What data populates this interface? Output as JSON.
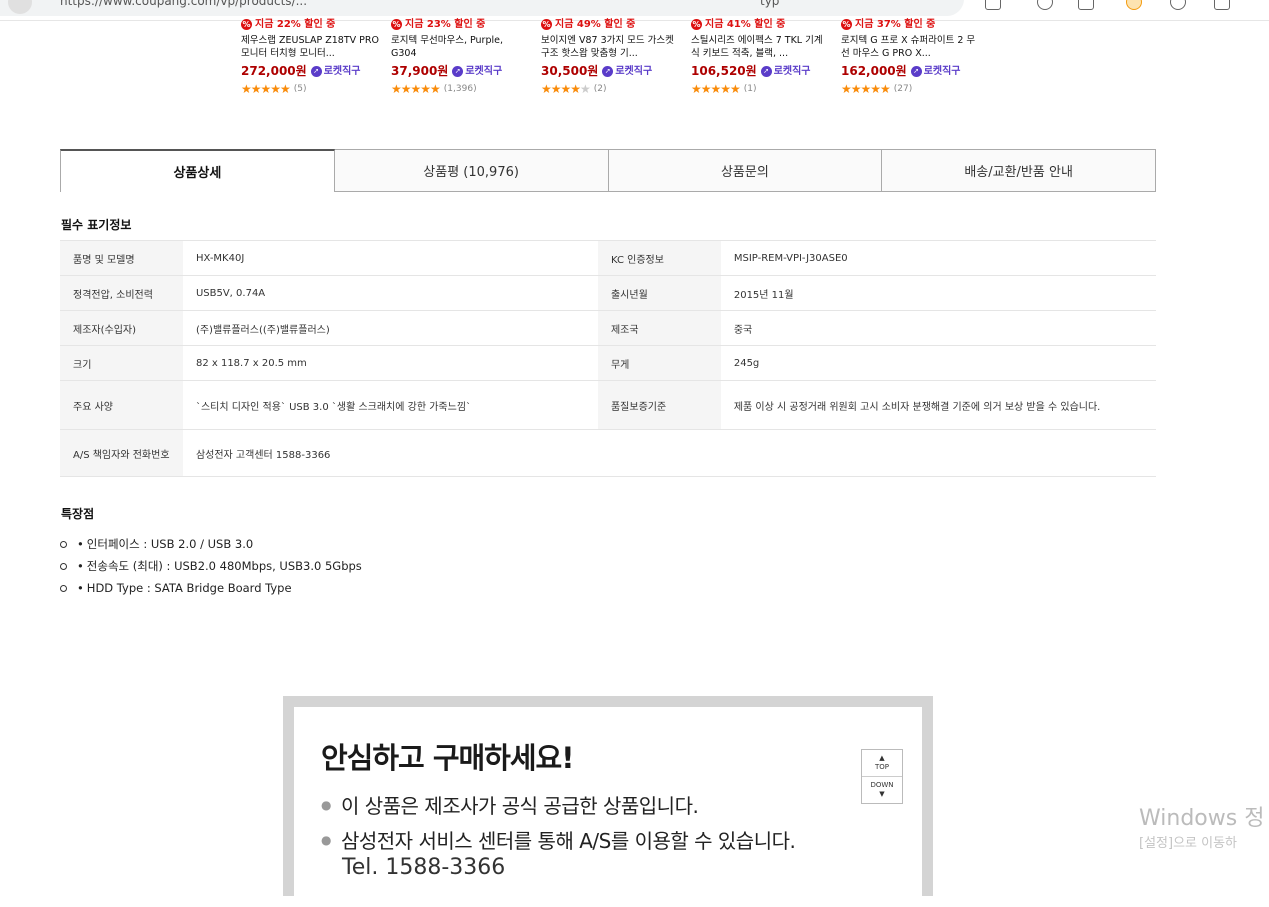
{
  "browser": {
    "address_text": "https://www.coupang.com/vp/products/...",
    "address_right": "typ"
  },
  "products": [
    {
      "discount": "지금 22% 할인 중",
      "name": "제우스랩 ZEUSLAP Z18TV PRO 모니터 터치형 모니터...",
      "price": "272,000원",
      "rocket": "로켓직구",
      "rating": 5,
      "reviews": "(5)"
    },
    {
      "discount": "지금 23% 할인 중",
      "name": "로지텍 무선마우스, Purple, G304",
      "price": "37,900원",
      "rocket": "로켓직구",
      "rating": 5,
      "reviews": "(1,396)"
    },
    {
      "discount": "지금 49% 할인 중",
      "name": "보이지엔 V87 3가지 모드 가스켓 구조 핫스왑 맞춤형 기...",
      "price": "30,500원",
      "rocket": "로켓직구",
      "rating": 4,
      "reviews": "(2)"
    },
    {
      "discount": "지금 41% 할인 중",
      "name": "스틸시리즈 에이펙스 7 TKL 기계식 키보드 적축, 블랙, ...",
      "price": "106,520원",
      "rocket": "로켓직구",
      "rating": 5,
      "reviews": "(1)"
    },
    {
      "discount": "지금 37% 할인 중",
      "name": "로지텍 G 프로 X 슈퍼라이트 2 무선 마우스 G PRO X...",
      "price": "162,000원",
      "rocket": "로켓직구",
      "rating": 4.5,
      "reviews": "(27)"
    }
  ],
  "tabs": [
    {
      "label": "상품상세",
      "active": true
    },
    {
      "label": "상품평 (10,976)",
      "active": false
    },
    {
      "label": "상품문의",
      "active": false
    },
    {
      "label": "배송/교환/반품 안내",
      "active": false
    }
  ],
  "required_info": {
    "title": "필수 표기정보",
    "rows": [
      [
        "품명 및 모델명",
        "HX-MK40J",
        "KC 인증정보",
        "MSIP-REM-VPI-J30ASE0"
      ],
      [
        "정격전압, 소비전력",
        "USB5V, 0.74A",
        "출시년월",
        "2015년 11월"
      ],
      [
        "제조자(수입자)",
        "(주)밸류플러스((주)밸류플러스)",
        "제조국",
        "중국"
      ],
      [
        "크기",
        "82 x 118.7 x 20.5 mm",
        "무게",
        "245g"
      ],
      [
        "주요 사양",
        "`스티치 디자인 적용` USB 3.0 `생활 스크래치에 강한 가죽느낌`",
        "품질보증기준",
        "제품 이상 시 공정거래 위원회 고시 소비자 분쟁해결 기준에 의거 보상 받을 수 있습니다."
      ],
      [
        "A/S 책임자와 전화번호",
        "삼성전자 고객센터 1588-3366",
        "",
        ""
      ]
    ]
  },
  "features": {
    "title": "특장점",
    "items": [
      "인터페이스 : USB 2.0 / USB 3.0",
      "전송속도 (최대) : USB2.0 480Mbps, USB3.0 5Gbps",
      "HDD Type : SATA Bridge Board Type"
    ]
  },
  "banner": {
    "title": "안심하고 구매하세요!",
    "line1": "이 상품은 제조사가 공식 공급한 상품입니다.",
    "line2": "삼성전자 서비스 센터를 통해 A/S를 이용할 수 있습니다.",
    "tel": "Tel.  1588-3366"
  },
  "scroll_buttons": {
    "top": "TOP",
    "down": "DOWN"
  },
  "watermark": {
    "line1": "Windows 정",
    "line2": "[설정]으로 이동하"
  },
  "colors": {
    "price": "#ae0000",
    "rocket": "#5a3cc9",
    "discount": "#dd1111",
    "star": "#f98b0a"
  }
}
